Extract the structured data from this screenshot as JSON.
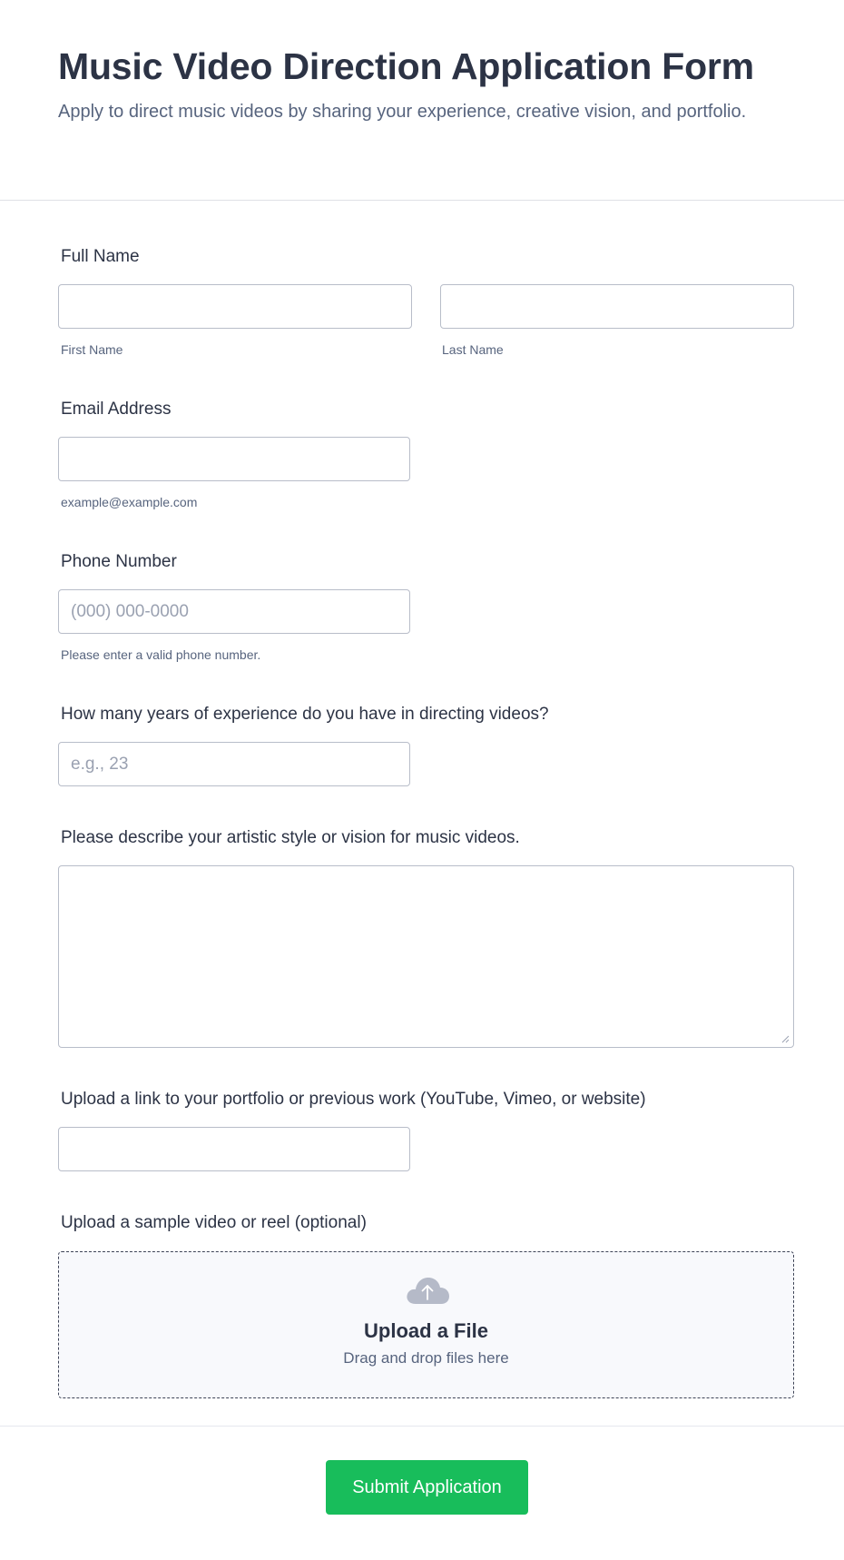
{
  "form": {
    "title": "Music Video Direction Application Form",
    "subtitle": "Apply to direct music videos by sharing your experience, creative vision, and portfolio."
  },
  "fields": {
    "full_name": {
      "label": "Full Name",
      "first": {
        "sublabel": "First Name",
        "value": "",
        "placeholder": ""
      },
      "last": {
        "sublabel": "Last Name",
        "value": "",
        "placeholder": ""
      }
    },
    "email": {
      "label": "Email Address",
      "sublabel": "example@example.com",
      "value": "",
      "placeholder": ""
    },
    "phone": {
      "label": "Phone Number",
      "sublabel": "Please enter a valid phone number.",
      "value": "",
      "placeholder": "(000) 000-0000"
    },
    "experience": {
      "label": "How many years of experience do you have in directing videos?",
      "value": "",
      "placeholder": "e.g., 23"
    },
    "vision": {
      "label": "Please describe your artistic style or vision for music videos.",
      "value": ""
    },
    "portfolio": {
      "label": "Upload a link to your portfolio or previous work (YouTube, Vimeo, or website)",
      "value": "",
      "placeholder": ""
    },
    "sample": {
      "label": "Upload a sample video or reel (optional)",
      "upload_title": "Upload a File",
      "upload_sub": "Drag and drop files here",
      "icon": "cloud-upload-icon"
    }
  },
  "submit": {
    "label": "Submit Application",
    "color": "#18bd5b"
  }
}
